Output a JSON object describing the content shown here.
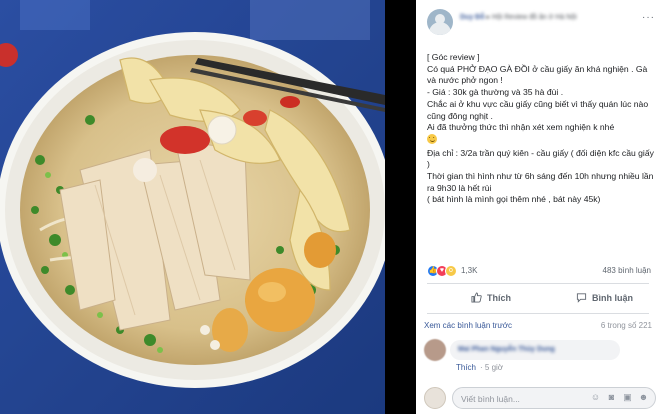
{
  "post": {
    "author_blurred": "Duy Đỗ",
    "group_blurred": "Hội Review đồ ăn ở Hà Nội",
    "lines": [
      "[ Góc review ]",
      "Có quá PHỞ ĐẠO GÀ ĐỒI ở cầu giấy ăn khá nghiện . Gà và nước phở ngon !",
      "- Giá : 30k gà thường và 35 hà đùi .",
      "Chắc ai ở khu vực cầu giấy cũng biết vì thấy quán lúc nào cũng đông nghịt .",
      "Ai đã thưởng thức thì nhận xét xem nghiện k nhé"
    ],
    "address": "Địa chỉ : 3/2a trần quý kiên - cầu giấy ( đối diện kfc cầu giấy )",
    "hours": "Thời gian thì hình như từ 6h sáng đến 10h nhưng nhiều lần ra 9h30 là hết rùi",
    "note": "( bát hình là mình gọi thêm nhé , bát này 45k)"
  },
  "stats": {
    "reaction_count": "1,3K",
    "shares": "483 bình luận"
  },
  "actions": {
    "like_label": "Thích",
    "comment_label": "Bình luận"
  },
  "comments": {
    "see_more": "Xem các bình luận trước",
    "count": "6 trong số 221",
    "first_name_blurred": "Mai Phan Nguyễn Thùy Dung",
    "reply_like": "Thích",
    "reply_time": "· 5 giờ",
    "write_placeholder": "Viết bình luận..."
  },
  "colors": {
    "link": "#385898",
    "like_blue": "#2078f4",
    "text": "#1c1e21"
  }
}
